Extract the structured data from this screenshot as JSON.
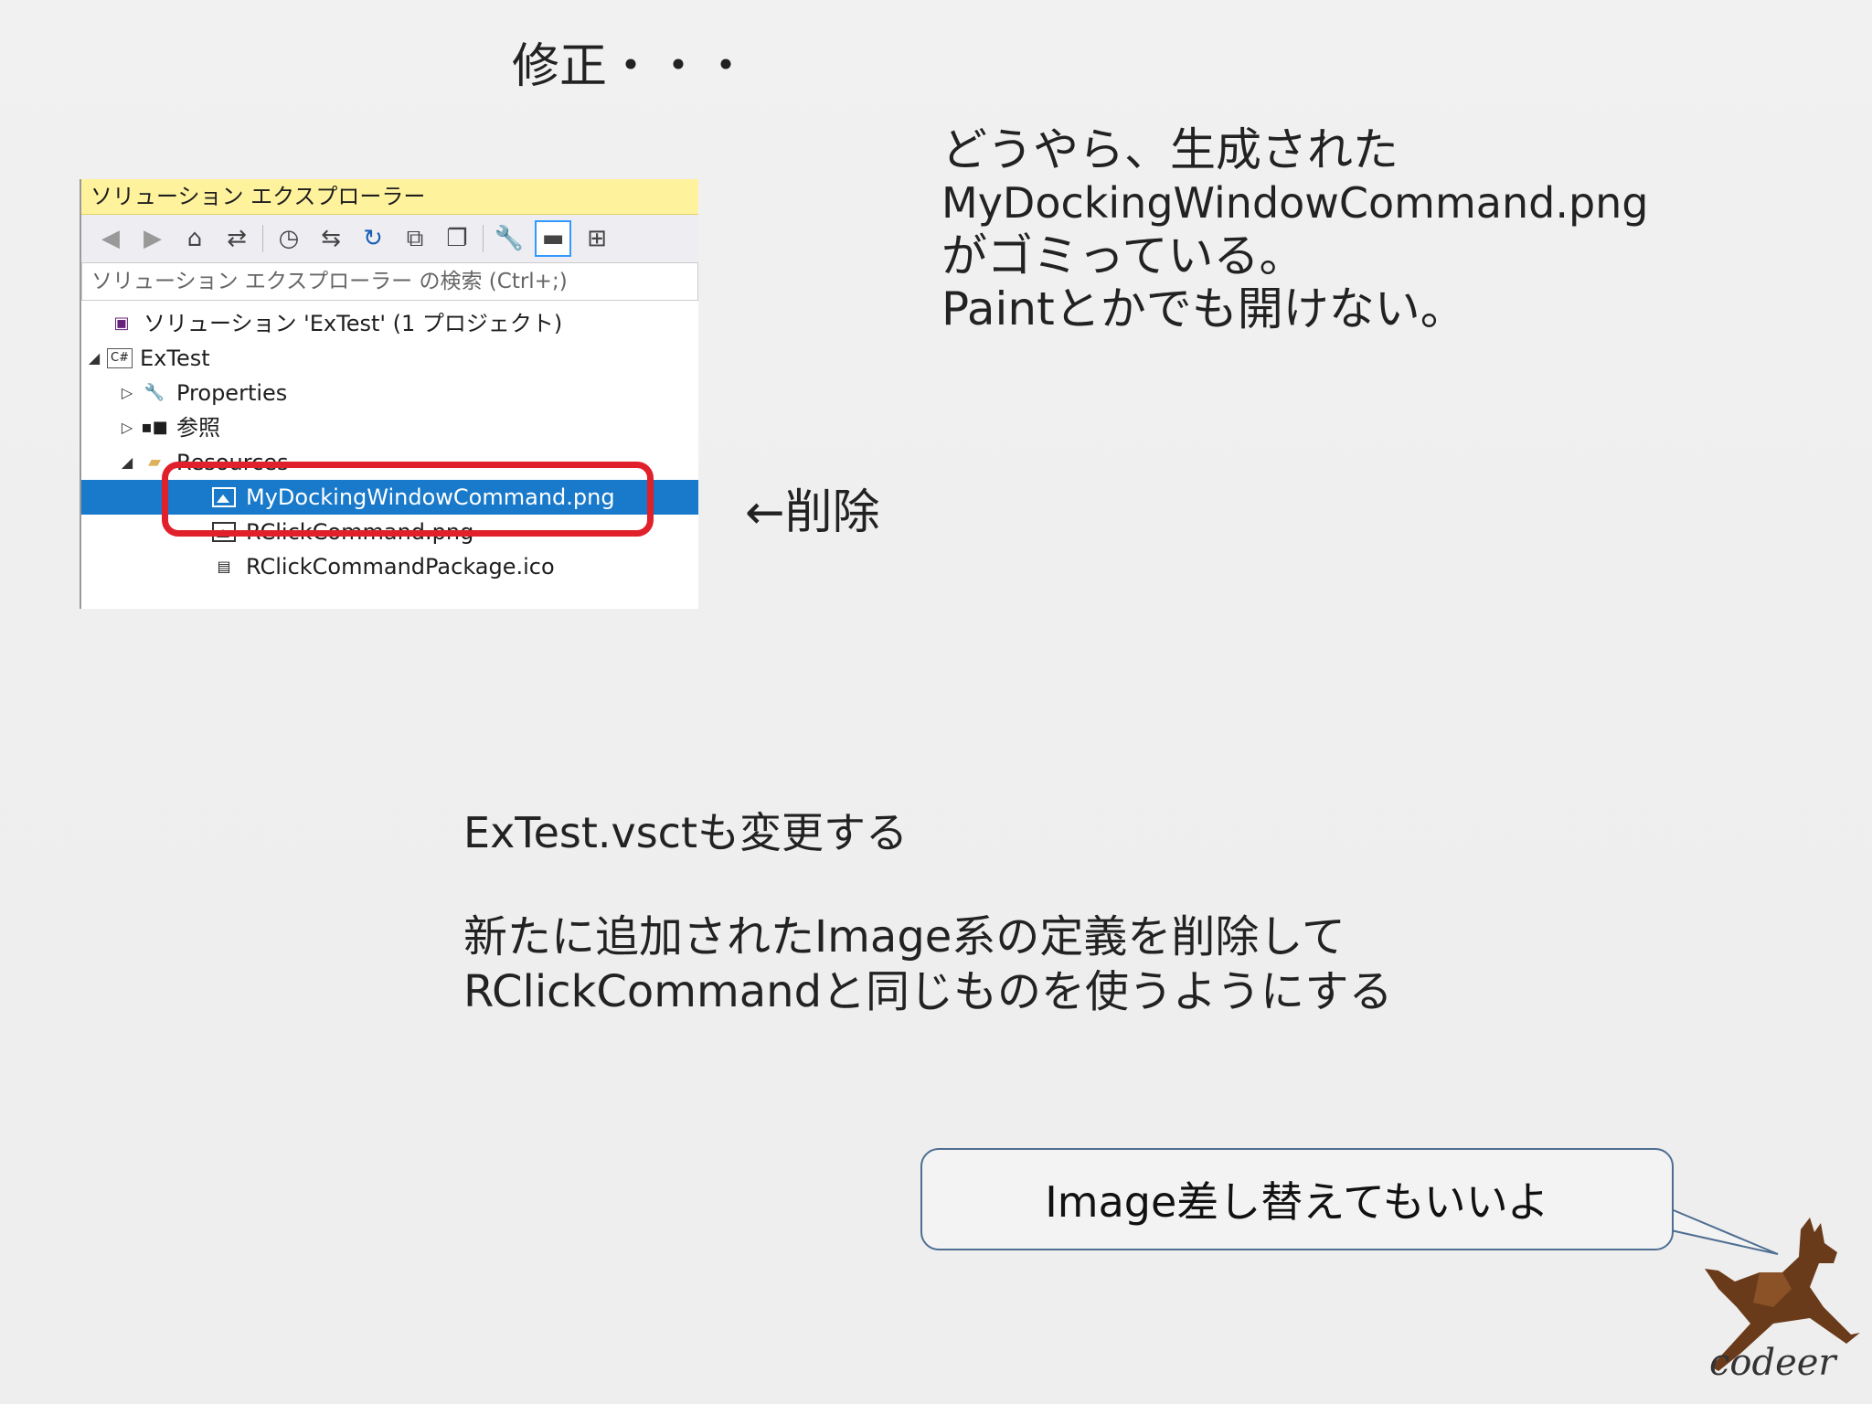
{
  "slide": {
    "title": "修正・・・",
    "note_line1": "どうやら、生成された",
    "note_line2": "MyDockingWindowCommand.png",
    "note_line3": "がゴミっている。",
    "note_line4": "Paintとかでも開けない。",
    "arrow_text": "←削除",
    "vsct_text": "ExTest.vsctも変更する",
    "def_line1": "新たに追加されたImage系の定義を削除して",
    "def_line2": "RClickCommandと同じものを使うようにする",
    "callout": "Image差し替えてもいいよ",
    "logo": "codeer"
  },
  "solution_explorer": {
    "title": "ソリューション エクスプローラー",
    "search_placeholder": "ソリューション エクスプローラー の検索 (Ctrl+;)",
    "toolbar_icons": [
      "back-icon",
      "forward-icon",
      "home-icon",
      "sync-icon",
      "history-icon",
      "switch-icon",
      "refresh-icon",
      "collapse-icon",
      "copy-icon",
      "properties-icon",
      "pin-icon",
      "diagram-icon"
    ],
    "tree": [
      {
        "label": "ソリューション 'ExTest' (1 プロジェクト)",
        "icon": "solution-icon"
      },
      {
        "label": "ExTest",
        "icon": "csharp-project-icon"
      },
      {
        "label": "Properties",
        "icon": "wrench-icon"
      },
      {
        "label": "参照",
        "icon": "references-icon"
      },
      {
        "label": "Resources",
        "icon": "folder-icon"
      },
      {
        "label": "MyDockingWindowCommand.png",
        "icon": "image-icon",
        "selected": true
      },
      {
        "label": "RClickCommand.png",
        "icon": "image-icon"
      },
      {
        "label": "RClickCommandPackage.ico",
        "icon": "ico-file-icon"
      }
    ],
    "colors": {
      "title_bg": "#fff29d",
      "selection": "#1979ca",
      "highlight_ring": "#e0202a"
    }
  }
}
